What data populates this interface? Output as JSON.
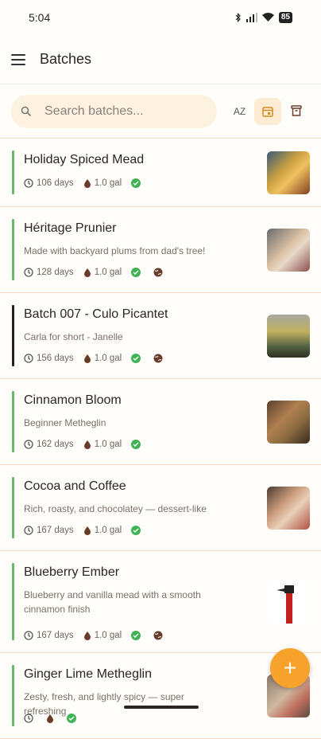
{
  "status": {
    "time": "5:04",
    "battery": "85"
  },
  "app_bar": {
    "title": "Batches"
  },
  "search": {
    "placeholder": "Search batches..."
  },
  "toolbar": {
    "sort_label": "AZ"
  },
  "colors": {
    "accent": "#f6a22b",
    "bar_green": "#6cb66c",
    "bar_black": "#222222",
    "check": "#3fb455"
  },
  "batches": [
    {
      "title": "Holiday Spiced Mead",
      "description": "",
      "days": "106 days",
      "volume": "1.0 gal",
      "public": false,
      "bar": "green",
      "thumb": "mead-glasses"
    },
    {
      "title": "Héritage Prunier",
      "description": "Made with backyard plums from dad's tree!",
      "days": "128 days",
      "volume": "1.0 gal",
      "public": true,
      "bar": "green",
      "thumb": "glasses-table"
    },
    {
      "title": "Batch 007 - Culo Picantet",
      "description": "Carla for short - Janelle",
      "days": "156 days",
      "volume": "1.0 gal",
      "public": true,
      "bar": "black",
      "thumb": "wine-glass-sunset"
    },
    {
      "title": "Cinnamon Bloom",
      "description": "Beginner Metheglin",
      "days": "162 days",
      "volume": "1.0 gal",
      "public": false,
      "bar": "green",
      "thumb": "jars-shelf"
    },
    {
      "title": "Cocoa and Coffee",
      "description": "Rich, roasty, and chocolatey — dessert-like",
      "days": "167 days",
      "volume": "1.0 gal",
      "public": false,
      "bar": "green",
      "thumb": "glass-hand"
    },
    {
      "title": "Blueberry Ember",
      "description": "Blueberry and vanilla mead with a smooth cinnamon finish",
      "days": "167 days",
      "volume": "1.0 gal",
      "public": true,
      "bar": "green",
      "thumb": "red-bottle"
    },
    {
      "title": "Ginger Lime Metheglin",
      "description": "Zesty, fresh, and lightly spicy — super refreshing",
      "days": "",
      "volume": "",
      "public": false,
      "bar": "green",
      "thumb": "person-photo"
    }
  ]
}
